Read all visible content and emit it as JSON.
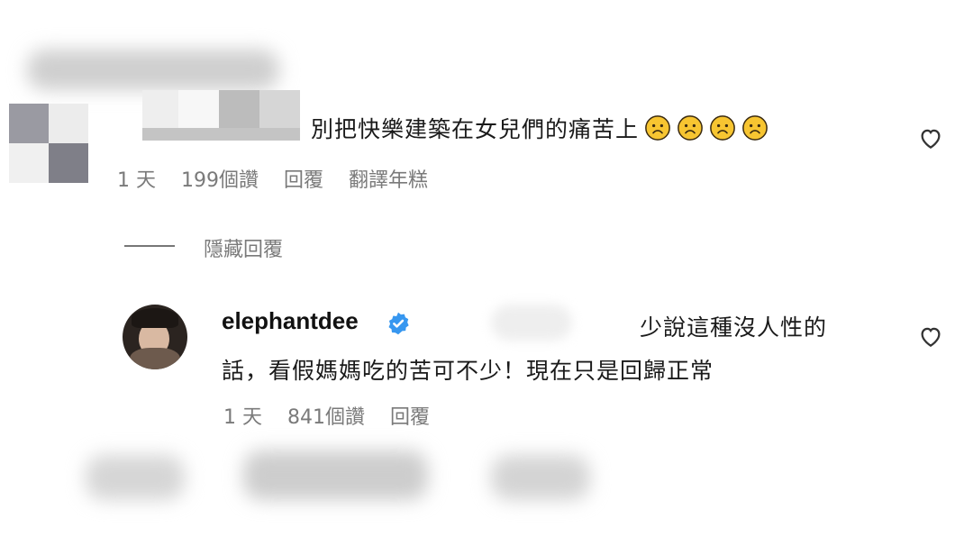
{
  "comment1": {
    "text": "別把快樂建築在女兒們的痛苦上",
    "emoji_count": 4,
    "emoji_icon": "frowning-face-icon",
    "time": "1 天",
    "likes": "199個讚",
    "reply": "回覆",
    "translate": "翻譯年糕"
  },
  "hide_replies": {
    "label": "隱藏回覆"
  },
  "comment2": {
    "username": "elephantdee",
    "verified_icon": "verified-badge-icon",
    "text_line1": "少說這種沒人性的",
    "text_line2": "話，看假媽媽吃的苦可不少！現在只是回歸正常",
    "time": "1 天",
    "likes": "841個讚",
    "reply": "回覆"
  },
  "colors": {
    "verified": "#3797f0",
    "meta": "#7a7a7a"
  }
}
